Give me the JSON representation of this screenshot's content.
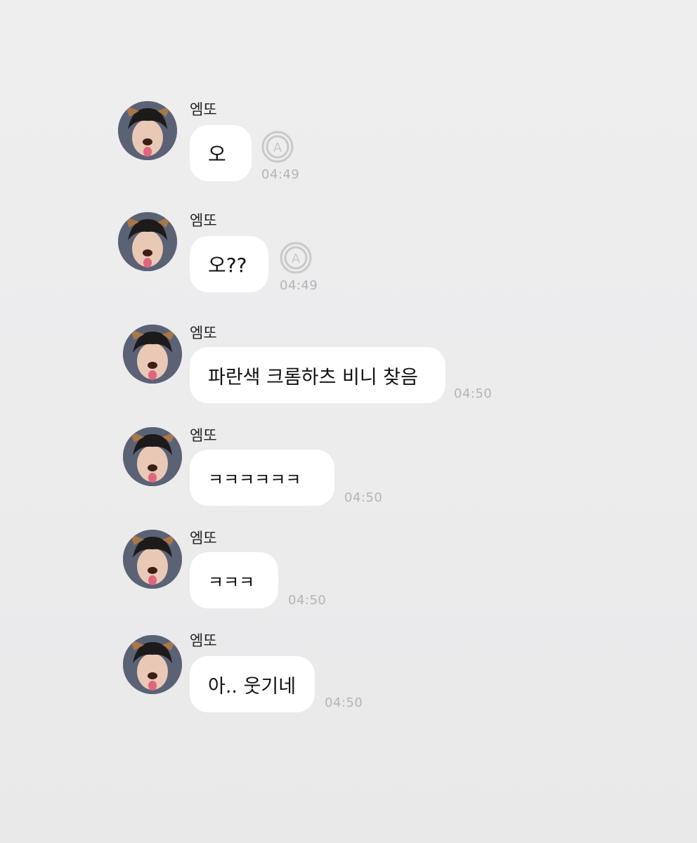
{
  "chat": {
    "messages": [
      {
        "sender": "엠또",
        "text": "오",
        "time": "04:49",
        "has_unread_icon": true,
        "unread_icon": "a-circle-icon",
        "unread_letter": "A"
      },
      {
        "sender": "엠또",
        "text": "오??",
        "time": "04:49",
        "has_unread_icon": true,
        "unread_icon": "a-circle-icon",
        "unread_letter": "A"
      },
      {
        "sender": "엠또",
        "text": "파란색 크롬하츠 비니 찾음",
        "time": "04:50",
        "has_unread_icon": false
      },
      {
        "sender": "엠또",
        "text": "ㅋㅋㅋㅋㅋㅋ",
        "time": "04:50",
        "has_unread_icon": false
      },
      {
        "sender": "엠또",
        "text": "ㅋㅋㅋ",
        "time": "04:50",
        "has_unread_icon": false
      },
      {
        "sender": "엠또",
        "text": "아.. 웃기네",
        "time": "04:50",
        "has_unread_icon": false
      }
    ]
  },
  "colors": {
    "background": "#ececed",
    "bubble": "#ffffff",
    "time_text": "#b4b4b6",
    "unread_icon": "#c9c9cb"
  }
}
